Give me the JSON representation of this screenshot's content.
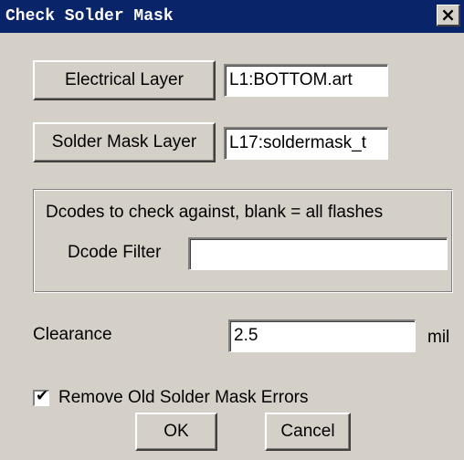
{
  "window": {
    "title": "Check Solder Mask",
    "close_glyph": "×"
  },
  "electrical": {
    "button_label": "Electrical Layer",
    "value": "L1:BOTTOM.art"
  },
  "solder_mask": {
    "button_label": "Solder Mask Layer",
    "value": "L17:soldermask_t"
  },
  "dcodes": {
    "heading": "Dcodes to check against, blank = all flashes",
    "filter_label": "Dcode Filter",
    "filter_value": ""
  },
  "clearance": {
    "label": "Clearance",
    "value": "2.5",
    "unit": "mil"
  },
  "remove_old": {
    "label": "Remove Old Solder Mask Errors",
    "checked": true,
    "check_glyph": "✔"
  },
  "actions": {
    "ok_label": "OK",
    "cancel_label": "Cancel"
  },
  "colors": {
    "titlebar": "#0a246a",
    "dialog_bg": "#d4d0c8"
  },
  "icons": {
    "close": "close-icon",
    "check": "checkmark-icon"
  }
}
